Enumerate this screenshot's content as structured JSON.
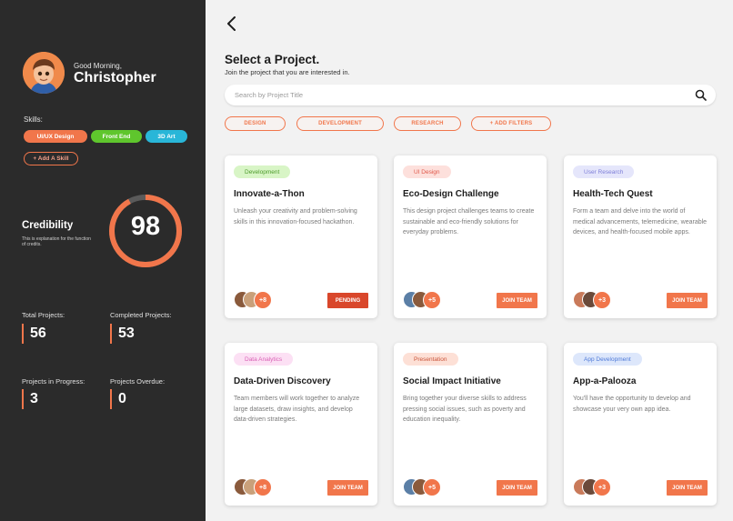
{
  "profile": {
    "greeting": "Good Morning,",
    "name": "Christopher"
  },
  "skills": {
    "label": "Skills:",
    "items": [
      {
        "label": "UI/UX Design",
        "color": "#f1764b"
      },
      {
        "label": "Front End",
        "color": "#5fc62d"
      },
      {
        "label": "3D Art",
        "color": "#29b6d8"
      }
    ],
    "add_label": "+ Add A Skill"
  },
  "credibility": {
    "title": "Credibility",
    "description": "This is explanation for the function of credits.",
    "score": "98",
    "score_fraction": 0.92
  },
  "stats": [
    {
      "label": "Total Projects:",
      "value": "56"
    },
    {
      "label": "Completed Projects:",
      "value": "53"
    },
    {
      "label": "Projects in Progress:",
      "value": "3"
    },
    {
      "label": "Projects Overdue:",
      "value": "0"
    }
  ],
  "header": {
    "title": "Select a Project.",
    "subtitle": "Join the project that you are interested in."
  },
  "search": {
    "placeholder": "Search by Project Title"
  },
  "filters": [
    {
      "label": "DESIGN"
    },
    {
      "label": "DEVELOPMENT"
    },
    {
      "label": "RESEARCH"
    },
    {
      "label": "+ ADD FILTERS"
    }
  ],
  "colors": {
    "accent": "#f1764b",
    "pending": "#d9472b",
    "sidebar": "#2b2b2b"
  },
  "projects": [
    {
      "tag": "Development",
      "tag_bg": "#d8f5c6",
      "tag_fg": "#4c9a2a",
      "title": "Innovate-a-Thon",
      "description": "Unleash your creativity and problem-solving skills in this innovation-focused hackathon.",
      "more": "+8",
      "action": "PENDING",
      "action_color": "#d9472b"
    },
    {
      "tag": "UI Design",
      "tag_bg": "#fde0dc",
      "tag_fg": "#e0584a",
      "title": "Eco-Design Challenge",
      "description": "This design project challenges teams to create sustainable and eco-friendly solutions for everyday problems.",
      "more": "+5",
      "action": "JOIN TEAM",
      "action_color": "#f1764b"
    },
    {
      "tag": "User Research",
      "tag_bg": "#e5e6fb",
      "tag_fg": "#7e7fd8",
      "title": "Health-Tech Quest",
      "description": "Form a team and delve into the world of medical advancements, telemedicine, wearable devices, and health-focused mobile apps.",
      "more": "+3",
      "action": "JOIN TEAM",
      "action_color": "#f1764b"
    },
    {
      "tag": "Data Analytics",
      "tag_bg": "#fce0f4",
      "tag_fg": "#d860b4",
      "title": "Data-Driven Discovery",
      "description": "Team members will work together to analyze large datasets, draw insights, and develop data-driven strategies.",
      "more": "+8",
      "action": "JOIN TEAM",
      "action_color": "#f1764b"
    },
    {
      "tag": "Presentation",
      "tag_bg": "#fde0d6",
      "tag_fg": "#c9543a",
      "title": "Social Impact Initiative",
      "description": "Bring together your diverse skills to address pressing social issues, such as poverty and education inequality.",
      "more": "+5",
      "action": "JOIN TEAM",
      "action_color": "#f1764b"
    },
    {
      "tag": "App Development",
      "tag_bg": "#dde7fb",
      "tag_fg": "#4f7ad8",
      "title": "App-a-Palooza",
      "description": "You'll have the opportunity to develop and showcase your very own app idea.",
      "more": "+3",
      "action": "JOIN TEAM",
      "action_color": "#f1764b"
    }
  ]
}
